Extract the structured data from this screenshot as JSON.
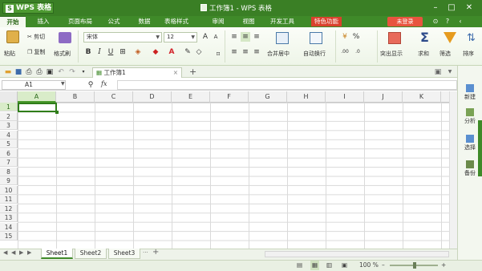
{
  "titlebar": {
    "app_name": "WPS 表格",
    "logo": "S",
    "window_title": "工作簿1 - WPS 表格"
  },
  "menubar": {
    "items": [
      "开始",
      "插入",
      "页面布局",
      "公式",
      "数据",
      "表格样式",
      "审阅",
      "视图",
      "开发工具",
      "特色功能"
    ],
    "login": "未登录"
  },
  "ribbon": {
    "paste": "粘贴",
    "cut": "剪切",
    "copy": "复制",
    "format_painter": "格式刷",
    "font_name": "宋体",
    "font_size": "12",
    "bold": "B",
    "italic": "I",
    "underline": "U",
    "merge_center": "合并居中",
    "wrap_text": "自动换行",
    "percent": "%",
    "show_hide": "突出显示",
    "sum": "求和",
    "filter": "筛选",
    "sort": "排序"
  },
  "tabs": {
    "doc_tab": "工作簿1"
  },
  "formula": {
    "name_box": "A1",
    "fx": "fx"
  },
  "grid": {
    "columns": [
      "A",
      "B",
      "C",
      "D",
      "E",
      "F",
      "G",
      "H",
      "I",
      "J",
      "K"
    ],
    "rows": [
      "1",
      "2",
      "3",
      "4",
      "5",
      "6",
      "7",
      "8",
      "9",
      "10",
      "11",
      "12",
      "13",
      "14",
      "15"
    ],
    "active_cell": "A1"
  },
  "taskpane": {
    "items": [
      "新建",
      "分析",
      "选择",
      "备份"
    ]
  },
  "sheets": [
    "Sheet1",
    "Sheet2",
    "Sheet3"
  ],
  "status": {
    "zoom": "100 %"
  },
  "colors": {
    "brand_green": "#3a7f25",
    "accent_red": "#d9412d",
    "active_cell": "#2f7d19"
  }
}
